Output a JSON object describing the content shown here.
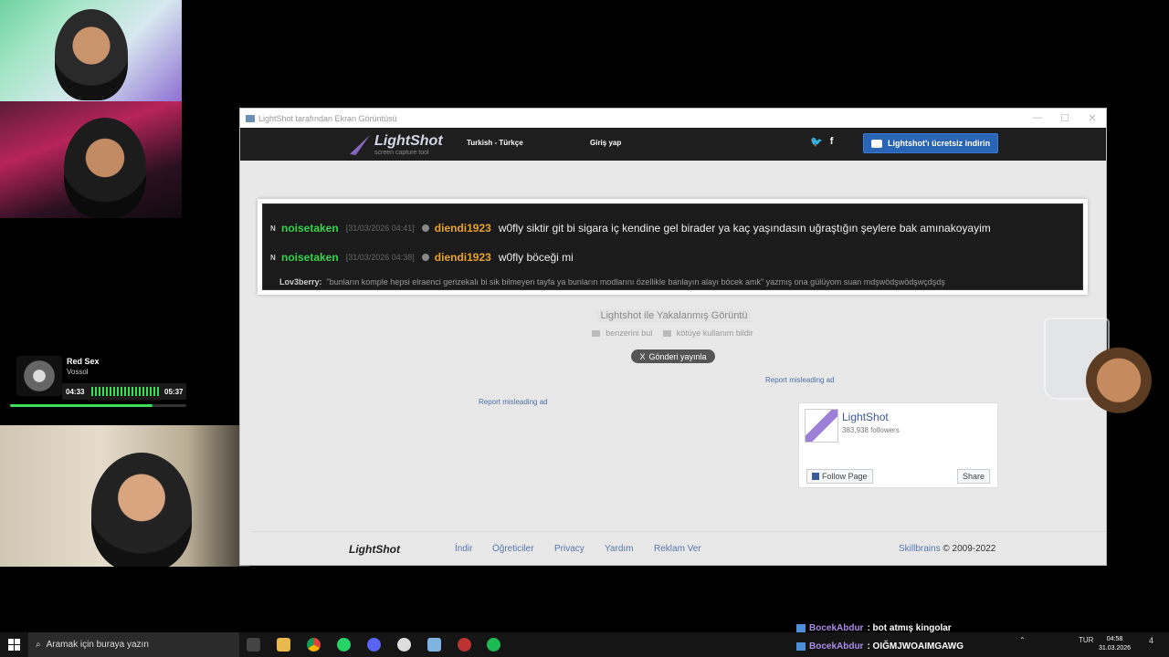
{
  "window": {
    "title": "LightShot tarafından Ekran Görüntüsü",
    "controls": [
      "—",
      "☐",
      "✕"
    ]
  },
  "navbar": {
    "logo_name": "LightShot",
    "logo_sub": "screen capture tool",
    "language": "Turkish - Türkçe",
    "login": "Giriş yap",
    "twitter": "🐦",
    "facebook": "f",
    "download": "Lightshot'ı ücretsiz indirin"
  },
  "chat": {
    "lines": [
      {
        "badge": "N",
        "user": "noisetaken",
        "time": "[31/03/2026 04:41]",
        "target": "diendi1923",
        "message": "w0fly siktir git bi sigara iç kendine gel birader ya kaç yaşındasın uğraştığın şeylere bak amınakoyayim"
      },
      {
        "badge": "N",
        "user": "noisetaken",
        "time": "[31/03/2026 04:38]",
        "target": "diendi1923",
        "message": "w0fly böceği mi"
      }
    ],
    "reply_user": "Lov3berry:",
    "reply_text": "\"bunların komple hepsi elraenci gerizekalı bi sik bilmeyen tayfa ya bunların modlarını özellikle banlayın alayı böcek amk\" yazmış ona gülüyom suan mdşwödşwödşwçdşdş"
  },
  "caption": "Lightshot ile Yakalanmış Görüntü",
  "actions": {
    "similar": "benzerini bul",
    "report_abuse": "kötüye kullanım bildir"
  },
  "post_button": "Gönderi yayınla",
  "post_icon": "X",
  "report_ad_1": "Report misleading ad",
  "report_ad_2": "Report misleading ad",
  "fb": {
    "name": "LightShot",
    "followers": "383,938 followers",
    "follow": "Follow Page",
    "share": "Share"
  },
  "footer": {
    "logo": "LightShot",
    "links": [
      "İndir",
      "Öğreticiler",
      "Privacy",
      "Yardım",
      "Reklam Ver"
    ],
    "brand": "Skillbrains",
    "copyright": "© 2009-2022"
  },
  "music": {
    "title": "Red Sex",
    "artist": "Vossol",
    "elapsed": "04:33",
    "total": "05:37",
    "progress": 0.81
  },
  "overlay_chat": [
    {
      "user": "BocekAbdur",
      "message": ": bot atmış kingolar"
    },
    {
      "user": "BocekAbdur",
      "message": ": OIĞMJWOAIMGAWG"
    }
  ],
  "taskbar": {
    "search_placeholder": "Aramak için buraya yazın",
    "lang": "TUR",
    "time": "04:58",
    "date": "31.03.2026",
    "notifications": "4"
  }
}
